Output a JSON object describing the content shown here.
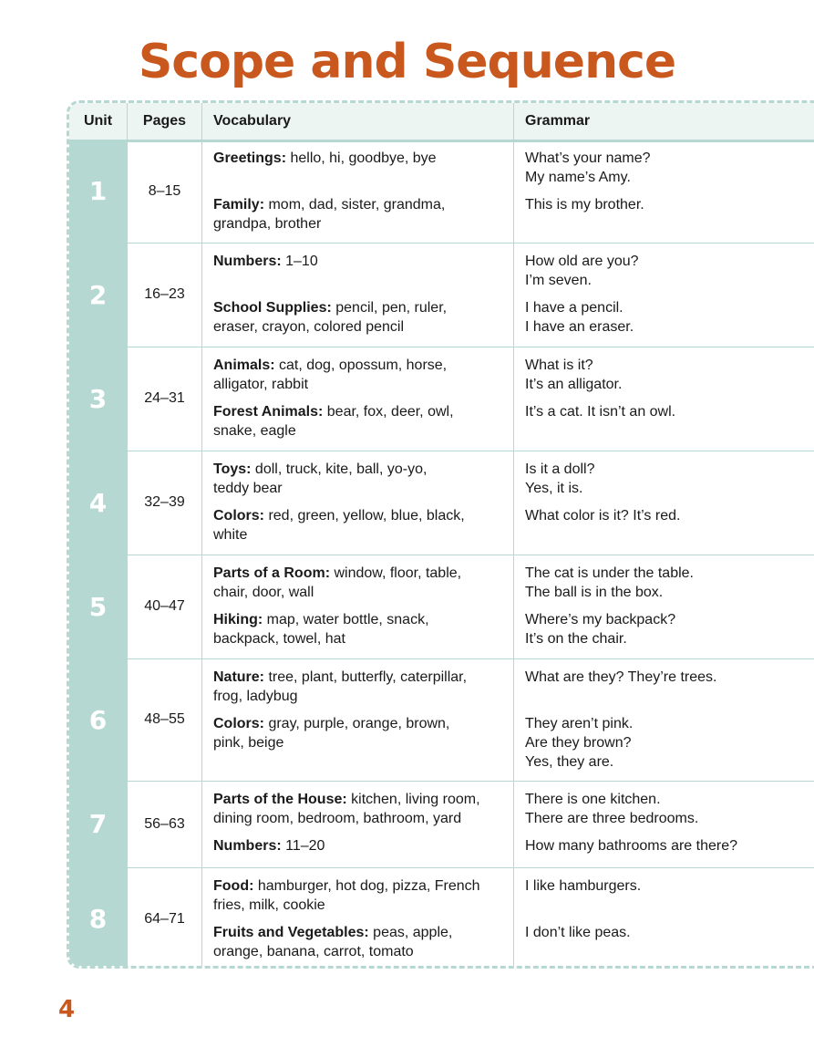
{
  "title": "Scope and Sequence",
  "page_number": "4",
  "headers": {
    "unit": "Unit",
    "pages": "Pages",
    "vocabulary": "Vocabulary",
    "grammar": "Grammar"
  },
  "units": [
    {
      "unit": "1",
      "pages": "8–15",
      "vocab1_label": "Greetings:",
      "vocab1_l1": " hello, hi, goodbye, bye",
      "vocab1_l2": "",
      "vocab2_label": "Family:",
      "vocab2_l1": " mom, dad, sister, grandma,",
      "vocab2_l2": "grandpa, brother",
      "grammar1": [
        "What’s your name?",
        "My name’s Amy."
      ],
      "grammar2": [
        "This is my brother."
      ]
    },
    {
      "unit": "2",
      "pages": "16–23",
      "vocab1_label": "Numbers:",
      "vocab1_l1": " 1–10",
      "vocab1_l2": "",
      "vocab2_label": "School Supplies:",
      "vocab2_l1": " pencil, pen, ruler,",
      "vocab2_l2": "eraser, crayon, colored pencil",
      "grammar1": [
        "How old are you?",
        "I’m seven."
      ],
      "grammar2": [
        "I have a pencil.",
        "I have an eraser."
      ]
    },
    {
      "unit": "3",
      "pages": "24–31",
      "vocab1_label": "Animals:",
      "vocab1_l1": " cat, dog, opossum, horse,",
      "vocab1_l2": "alligator, rabbit",
      "vocab2_label": "Forest Animals:",
      "vocab2_l1": " bear, fox, deer, owl,",
      "vocab2_l2": "snake, eagle",
      "grammar1": [
        "What is it?",
        "It’s an alligator."
      ],
      "grammar2": [
        "It’s a cat.  It isn’t an owl."
      ]
    },
    {
      "unit": "4",
      "pages": "32–39",
      "vocab1_label": "Toys:",
      "vocab1_l1": " doll, truck, kite, ball, yo-yo,",
      "vocab1_l2": "teddy bear",
      "vocab2_label": "Colors:",
      "vocab2_l1": " red, green, yellow, blue, black,",
      "vocab2_l2": "white",
      "grammar1": [
        "Is it a doll?",
        "Yes, it is."
      ],
      "grammar2": [
        "What color is it? It’s red."
      ]
    },
    {
      "unit": "5",
      "pages": "40–47",
      "vocab1_label": "Parts of a Room:",
      "vocab1_l1": " window, floor, table,",
      "vocab1_l2": "chair, door, wall",
      "vocab2_label": "Hiking:",
      "vocab2_l1": " map, water bottle, snack,",
      "vocab2_l2": "backpack, towel, hat",
      "grammar1": [
        "The cat is under the table.",
        "The ball is in the box."
      ],
      "grammar2": [
        "Where’s my backpack?",
        "It’s on the chair."
      ]
    },
    {
      "unit": "6",
      "pages": "48–55",
      "vocab1_label": "Nature:",
      "vocab1_l1": " tree, plant, butterfly, caterpillar,",
      "vocab1_l2": "frog, ladybug",
      "vocab2_label": "Colors:",
      "vocab2_l1": " gray, purple, orange, brown,",
      "vocab2_l2": "pink, beige",
      "grammar1": [
        "What are they? They’re trees."
      ],
      "grammar2": [
        "They aren’t pink.",
        "Are they brown?",
        "Yes, they are."
      ]
    },
    {
      "unit": "7",
      "pages": "56–63",
      "vocab1_label": "Parts of the House:",
      "vocab1_l1": " kitchen, living room,",
      "vocab1_l2": "dining room, bedroom, bathroom, yard",
      "vocab2_label": "Numbers:",
      "vocab2_l1": " 11–20",
      "vocab2_l2": "",
      "grammar1": [
        "There is one kitchen.",
        "There are three bedrooms."
      ],
      "grammar2": [
        "How many bathrooms are there?"
      ]
    },
    {
      "unit": "8",
      "pages": "64–71",
      "vocab1_label": "Food:",
      "vocab1_l1": " hamburger, hot dog, pizza, French",
      "vocab1_l2": "fries, milk, cookie",
      "vocab2_label": "Fruits and Vegetables:",
      "vocab2_l1": " peas, apple,",
      "vocab2_l2": "orange, banana, carrot, tomato",
      "grammar1": [
        "I like hamburgers."
      ],
      "grammar2": [
        "I don’t like peas."
      ]
    }
  ]
}
